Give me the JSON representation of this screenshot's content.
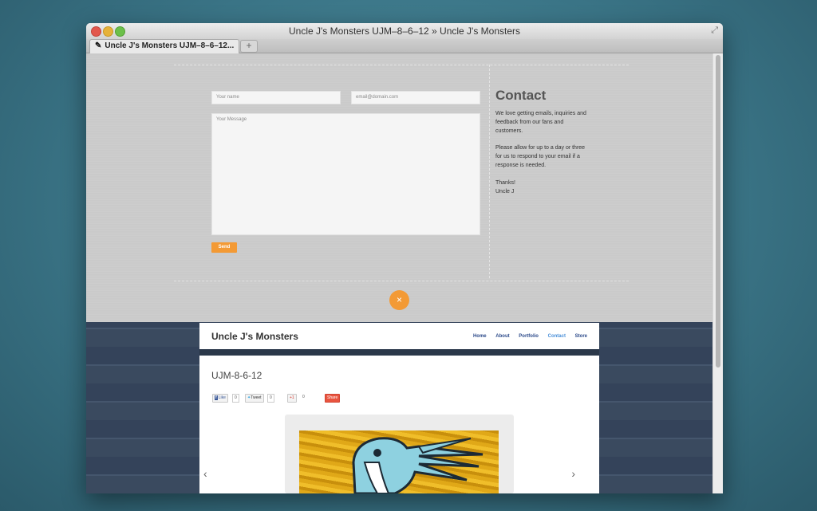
{
  "window": {
    "title": "Uncle J's Monsters UJM–8–6–12 » Uncle J's Monsters",
    "tab_label": "Uncle J's Monsters UJM–8–6–12...",
    "new_tab": "+"
  },
  "contact_form": {
    "name_placeholder": "Your name",
    "email_placeholder": "email@domain.com",
    "message_placeholder": "Your Message",
    "send_label": "Send",
    "close_label": "×"
  },
  "contact_info": {
    "heading": "Contact",
    "paragraph1": "We love getting emails, inquiries and feedback from our fans and customers.",
    "paragraph2": "Please allow for up to a day or three for us to respond to your email if a response is needed.",
    "thanks": "Thanks!",
    "signature": "Uncle J"
  },
  "site": {
    "title": "Uncle J's Monsters",
    "nav": [
      "Home",
      "About",
      "Portfolio",
      "Contact",
      "Store"
    ],
    "active_nav": "Contact",
    "post_title": "UJM-8-6-12",
    "share": {
      "like_label": "Like",
      "like_count": "0",
      "tweet_label": "Tweet",
      "tweet_count": "0",
      "plusone_label": "+1",
      "plusone_count": "0",
      "share_label": "Share"
    },
    "prev_arrow": "‹",
    "next_arrow": "›"
  },
  "colors": {
    "accent_orange": "#f39a35",
    "nav_blue": "#2c4a8a",
    "active_blue": "#4a90d9"
  }
}
